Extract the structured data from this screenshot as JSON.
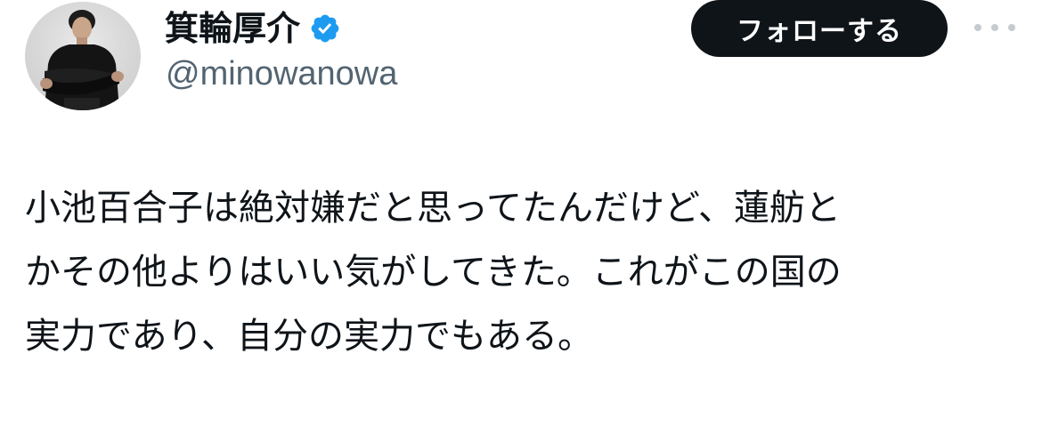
{
  "author": {
    "display_name": "箕輪厚介",
    "handle": "@minowanowa",
    "verified": true,
    "avatar_icon": "user-avatar-photo"
  },
  "actions": {
    "follow_label": "フォローする",
    "more_icon": "more-options-icon"
  },
  "tweet": {
    "lines": [
      "小池百合子は絶対嫌だと思ってたんだけど、蓮舫と",
      "かその他よりはいい気がしてきた。これがこの国の",
      "実力であり、自分の実力でもある。"
    ]
  },
  "colors": {
    "text": "#0f1419",
    "secondary": "#536471",
    "verified_blue": "#1d9bf0",
    "button_bg": "#0f1419",
    "button_text": "#ffffff"
  }
}
